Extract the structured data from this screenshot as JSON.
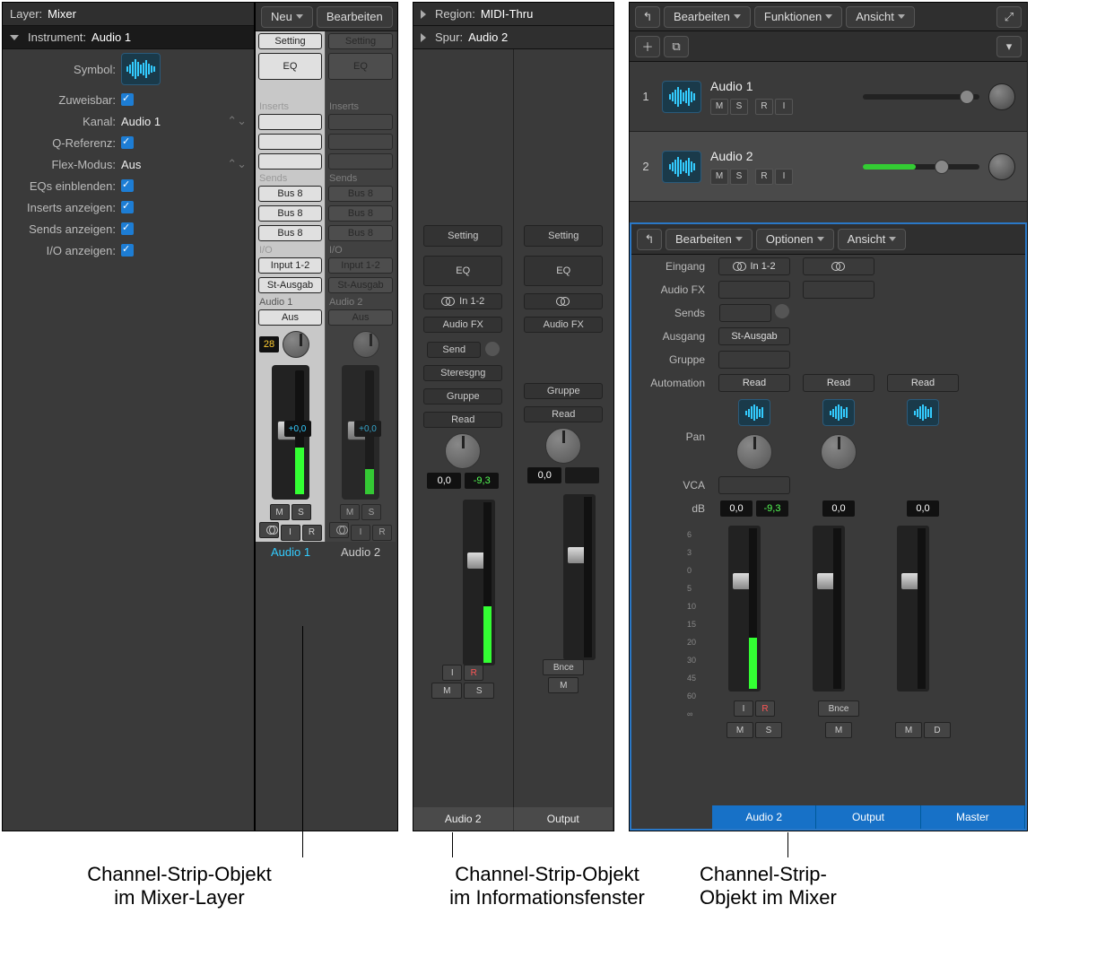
{
  "inspector": {
    "layerLabel": "Layer:",
    "layerValue": "Mixer",
    "instLabel": "Instrument:",
    "instValue": "Audio 1",
    "rows": [
      {
        "l": "Symbol:",
        "type": "icon"
      },
      {
        "l": "Zuweisbar:",
        "type": "chk"
      },
      {
        "l": "Kanal:",
        "v": "Audio 1",
        "type": "sel"
      },
      {
        "l": "Q-Referenz:",
        "type": "chk"
      },
      {
        "l": "Flex-Modus:",
        "v": "Aus",
        "type": "sel"
      },
      {
        "l": "EQs einblenden:",
        "type": "chk"
      },
      {
        "l": "Inserts anzeigen:",
        "type": "chk"
      },
      {
        "l": "Sends anzeigen:",
        "type": "chk"
      },
      {
        "l": "I/O anzeigen:",
        "type": "chk"
      }
    ]
  },
  "stripsB": {
    "toolbar": [
      "Neu",
      "Bearbeiten"
    ],
    "setting": "Setting",
    "eq": "EQ",
    "inserts": "Inserts",
    "sends": "Sends",
    "bus": "Bus 8",
    "io": "I/O",
    "input": "Input 1-2",
    "output": "St-Ausgab",
    "names": [
      "Audio 1",
      "Audio 2"
    ],
    "aus": "Aus",
    "db": "+0,0",
    "peak": "28"
  },
  "panelC": {
    "regionLabel": "Region:",
    "regionValue": "MIDI-Thru",
    "spurLabel": "Spur:",
    "spurValue": "Audio 2",
    "strip": {
      "setting": "Setting",
      "eq": "EQ",
      "in": "In 1-2",
      "afx": "Audio FX",
      "send": "Send",
      "stereo": "Steresgng",
      "gruppe": "Gruppe",
      "read": "Read",
      "db1": "0,0",
      "db2": "-9,3",
      "ir": [
        "I",
        "R"
      ],
      "bnce": "Bnce",
      "m": "M",
      "s": "S"
    },
    "names": [
      "Audio 2",
      "Output"
    ]
  },
  "panelD": {
    "topbar": [
      "Bearbeiten",
      "Funktionen",
      "Ansicht"
    ],
    "tracks": [
      {
        "num": "1",
        "name": "Audio 1"
      },
      {
        "num": "2",
        "name": "Audio 2"
      }
    ],
    "mixer": {
      "bar": [
        "Bearbeiten",
        "Optionen",
        "Ansicht"
      ],
      "rows": {
        "eingang": "Eingang",
        "eingangV": "In 1-2",
        "afx": "Audio FX",
        "sends": "Sends",
        "ausgang": "Ausgang",
        "ausgangV": "St-Ausgab",
        "gruppe": "Gruppe",
        "automation": "Automation",
        "read": "Read",
        "pan": "Pan",
        "vca": "VCA",
        "db": "dB"
      },
      "dbvals": [
        [
          "0,0",
          "-9,3"
        ],
        [
          "0,0",
          ""
        ],
        [
          "0,0",
          ""
        ]
      ],
      "ticks": [
        "6",
        "3",
        "0",
        "5",
        "10",
        "15",
        "20",
        "30",
        "45",
        "60",
        "∞"
      ],
      "ir": [
        "I",
        "R"
      ],
      "bnce": "Bnce",
      "m": "M",
      "s": "S",
      "d": "D",
      "names": [
        "Audio 2",
        "Output",
        "Master"
      ]
    }
  },
  "captions": {
    "c1": "Channel-Strip-Objekt\nim Mixer-Layer",
    "c2": "Channel-Strip-Objekt\nim Informationsfenster",
    "c3": "Channel-Strip-\nObjekt im Mixer"
  }
}
